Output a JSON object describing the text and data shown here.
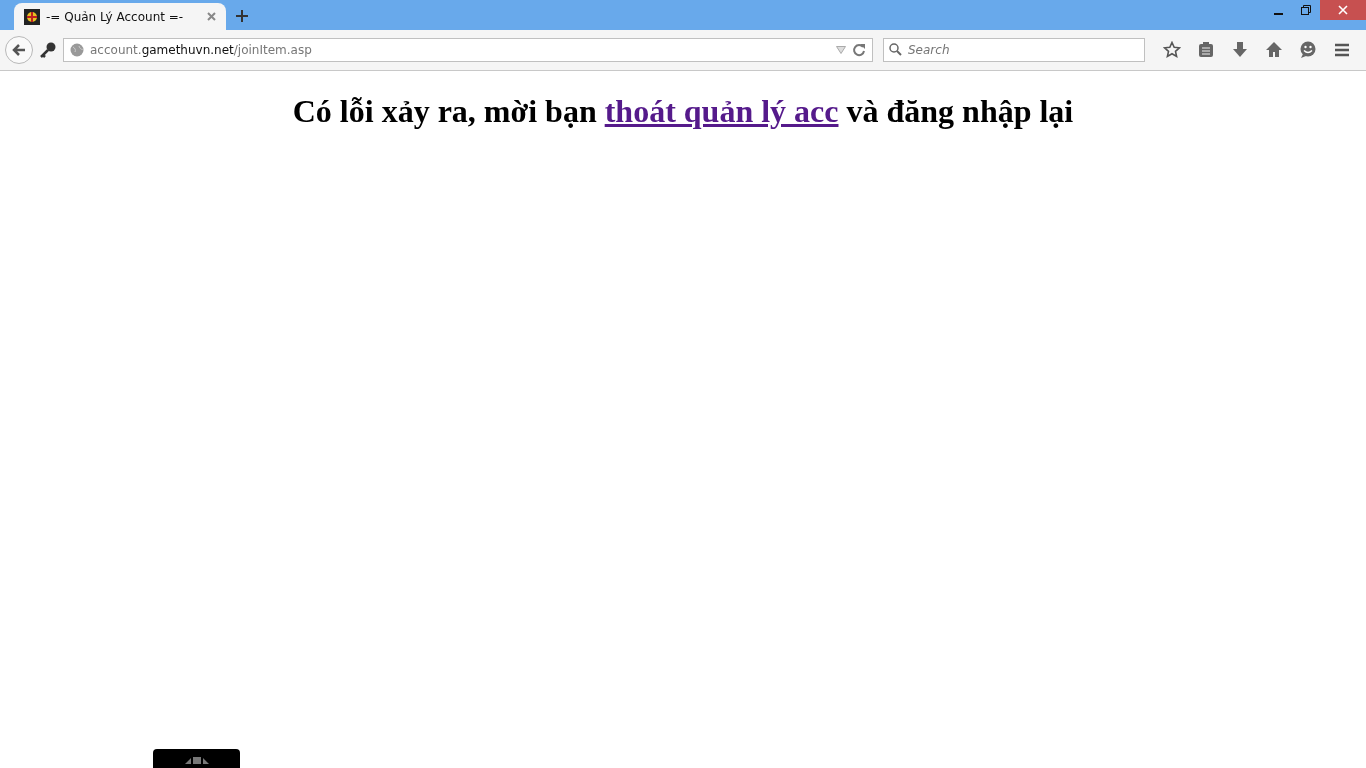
{
  "tabs": [
    {
      "title": "-= Quản Lý Account =-",
      "selected": true
    }
  ],
  "address_bar": {
    "url": "account.**gamethuvn.net**/joinItem.asp"
  },
  "search": {
    "placeholder": "Search"
  },
  "page": {
    "heading_before": "Có lỗi xảy ra, mời bạn ",
    "heading_link": "thoát quản lý acc",
    "heading_after": " và đăng nhập lại"
  }
}
